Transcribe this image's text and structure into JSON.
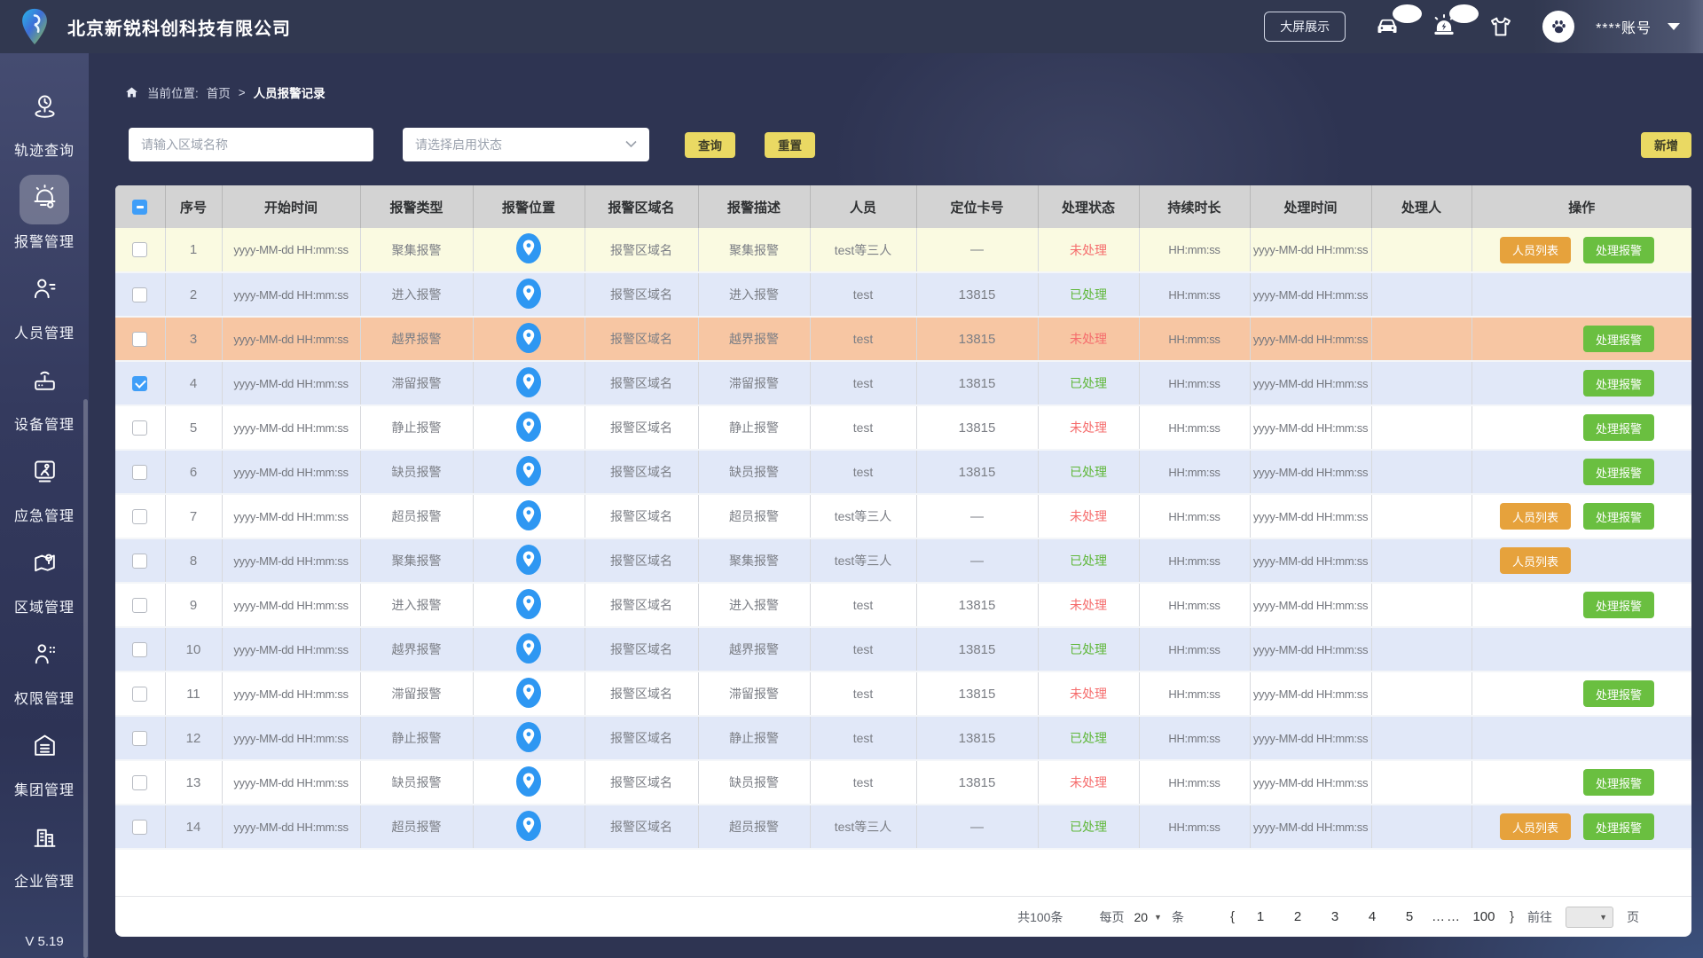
{
  "header": {
    "company_name": "北京新锐科创科技有限公司",
    "big_screen_label": "大屏展示",
    "account_label": "****账号",
    "icons": {
      "vehicle": "car-icon",
      "alarm": "siren-icon",
      "clothing": "tshirt-icon",
      "avatar": "paw-icon",
      "dropdown": "caret-down-icon"
    }
  },
  "sidebar": {
    "version": "V 5.19",
    "items": [
      {
        "id": "track",
        "label": "轨迹查询",
        "icon": "track-icon",
        "active": false
      },
      {
        "id": "alarm",
        "label": "报警管理",
        "icon": "alarm-icon",
        "active": true
      },
      {
        "id": "personnel",
        "label": "人员管理",
        "icon": "person-icon",
        "active": false
      },
      {
        "id": "device",
        "label": "设备管理",
        "icon": "device-icon",
        "active": false
      },
      {
        "id": "emergency",
        "label": "应急管理",
        "icon": "emergency-icon",
        "active": false
      },
      {
        "id": "region",
        "label": "区域管理",
        "icon": "region-icon",
        "active": false
      },
      {
        "id": "permission",
        "label": "权限管理",
        "icon": "permission-icon",
        "active": false
      },
      {
        "id": "group",
        "label": "集团管理",
        "icon": "group-icon",
        "active": false
      },
      {
        "id": "enterprise",
        "label": "企业管理",
        "icon": "enterprise-icon",
        "active": false
      }
    ]
  },
  "breadcrumb": {
    "prefix": "当前位置: ",
    "link": "首页",
    "separator": ">",
    "current": "人员报警记录"
  },
  "filters": {
    "area_placeholder": "请输入区域名称",
    "status_placeholder": "请选择启用状态",
    "search_label": "查询",
    "reset_label": "重置",
    "add_label": "新增"
  },
  "table": {
    "columns": [
      "序号",
      "开始时间",
      "报警类型",
      "报警位置",
      "报警区域名",
      "报警描述",
      "人员",
      "定位卡号",
      "处理状态",
      "持续时长",
      "处理时间",
      "处理人",
      "操作"
    ],
    "button_labels": {
      "person_list": "人员列表",
      "handle_alarm": "处理报警"
    },
    "status_values": {
      "pending": "未处理",
      "done": "已处理"
    },
    "rows": [
      {
        "index": 1,
        "start_time": "yyyy-MM-dd HH:mm:ss",
        "type": "聚集报警",
        "area": "报警区域名",
        "desc": "聚集报警",
        "person": "test等三人",
        "card": "—",
        "status": "未处理",
        "state": "pending",
        "duration": "HH:mm:ss",
        "handle_time": "yyyy-MM-dd HH:mm:ss",
        "handler": "",
        "buttons": [
          "person_list",
          "handle_alarm"
        ],
        "bg": "yellow",
        "checked": false
      },
      {
        "index": 2,
        "start_time": "yyyy-MM-dd HH:mm:ss",
        "type": "进入报警",
        "area": "报警区域名",
        "desc": "进入报警",
        "person": "test",
        "card": "13815",
        "status": "已处理",
        "state": "done",
        "duration": "HH:mm:ss",
        "handle_time": "yyyy-MM-dd HH:mm:ss",
        "handler": "",
        "buttons": [],
        "bg": "blue",
        "checked": false
      },
      {
        "index": 3,
        "start_time": "yyyy-MM-dd HH:mm:ss",
        "type": "越界报警",
        "area": "报警区域名",
        "desc": "越界报警",
        "person": "test",
        "card": "13815",
        "status": "未处理",
        "state": "pending",
        "duration": "HH:mm:ss",
        "handle_time": "yyyy-MM-dd HH:mm:ss",
        "handler": "",
        "buttons": [
          "handle_alarm"
        ],
        "bg": "orange",
        "checked": false
      },
      {
        "index": 4,
        "start_time": "yyyy-MM-dd HH:mm:ss",
        "type": "滞留报警",
        "area": "报警区域名",
        "desc": "滞留报警",
        "person": "test",
        "card": "13815",
        "status": "已处理",
        "state": "done",
        "duration": "HH:mm:ss",
        "handle_time": "yyyy-MM-dd HH:mm:ss",
        "handler": "",
        "buttons": [
          "handle_alarm"
        ],
        "bg": "blue",
        "checked": true
      },
      {
        "index": 5,
        "start_time": "yyyy-MM-dd HH:mm:ss",
        "type": "静止报警",
        "area": "报警区域名",
        "desc": "静止报警",
        "person": "test",
        "card": "13815",
        "status": "未处理",
        "state": "pending",
        "duration": "HH:mm:ss",
        "handle_time": "yyyy-MM-dd HH:mm:ss",
        "handler": "",
        "buttons": [
          "handle_alarm"
        ],
        "bg": "white",
        "checked": false
      },
      {
        "index": 6,
        "start_time": "yyyy-MM-dd HH:mm:ss",
        "type": "缺员报警",
        "area": "报警区域名",
        "desc": "缺员报警",
        "person": "test",
        "card": "13815",
        "status": "已处理",
        "state": "done",
        "duration": "HH:mm:ss",
        "handle_time": "yyyy-MM-dd HH:mm:ss",
        "handler": "",
        "buttons": [
          "handle_alarm"
        ],
        "bg": "blue",
        "checked": false
      },
      {
        "index": 7,
        "start_time": "yyyy-MM-dd HH:mm:ss",
        "type": "超员报警",
        "area": "报警区域名",
        "desc": "超员报警",
        "person": "test等三人",
        "card": "—",
        "status": "未处理",
        "state": "pending",
        "duration": "HH:mm:ss",
        "handle_time": "yyyy-MM-dd HH:mm:ss",
        "handler": "",
        "buttons": [
          "person_list",
          "handle_alarm"
        ],
        "bg": "white",
        "checked": false
      },
      {
        "index": 8,
        "start_time": "yyyy-MM-dd HH:mm:ss",
        "type": "聚集报警",
        "area": "报警区域名",
        "desc": "聚集报警",
        "person": "test等三人",
        "card": "—",
        "status": "已处理",
        "state": "done",
        "duration": "HH:mm:ss",
        "handle_time": "yyyy-MM-dd HH:mm:ss",
        "handler": "",
        "buttons": [
          "person_list"
        ],
        "bg": "blue",
        "checked": false
      },
      {
        "index": 9,
        "start_time": "yyyy-MM-dd HH:mm:ss",
        "type": "进入报警",
        "area": "报警区域名",
        "desc": "进入报警",
        "person": "test",
        "card": "13815",
        "status": "未处理",
        "state": "pending",
        "duration": "HH:mm:ss",
        "handle_time": "yyyy-MM-dd HH:mm:ss",
        "handler": "",
        "buttons": [
          "handle_alarm"
        ],
        "bg": "white",
        "checked": false
      },
      {
        "index": 10,
        "start_time": "yyyy-MM-dd HH:mm:ss",
        "type": "越界报警",
        "area": "报警区域名",
        "desc": "越界报警",
        "person": "test",
        "card": "13815",
        "status": "已处理",
        "state": "done",
        "duration": "HH:mm:ss",
        "handle_time": "yyyy-MM-dd HH:mm:ss",
        "handler": "",
        "buttons": [],
        "bg": "blue",
        "checked": false
      },
      {
        "index": 11,
        "start_time": "yyyy-MM-dd HH:mm:ss",
        "type": "滞留报警",
        "area": "报警区域名",
        "desc": "滞留报警",
        "person": "test",
        "card": "13815",
        "status": "未处理",
        "state": "pending",
        "duration": "HH:mm:ss",
        "handle_time": "yyyy-MM-dd HH:mm:ss",
        "handler": "",
        "buttons": [
          "handle_alarm"
        ],
        "bg": "white",
        "checked": false
      },
      {
        "index": 12,
        "start_time": "yyyy-MM-dd HH:mm:ss",
        "type": "静止报警",
        "area": "报警区域名",
        "desc": "静止报警",
        "person": "test",
        "card": "13815",
        "status": "已处理",
        "state": "done",
        "duration": "HH:mm:ss",
        "handle_time": "yyyy-MM-dd HH:mm:ss",
        "handler": "",
        "buttons": [],
        "bg": "blue",
        "checked": false
      },
      {
        "index": 13,
        "start_time": "yyyy-MM-dd HH:mm:ss",
        "type": "缺员报警",
        "area": "报警区域名",
        "desc": "缺员报警",
        "person": "test",
        "card": "13815",
        "status": "未处理",
        "state": "pending",
        "duration": "HH:mm:ss",
        "handle_time": "yyyy-MM-dd HH:mm:ss",
        "handler": "",
        "buttons": [
          "handle_alarm"
        ],
        "bg": "white",
        "checked": false
      },
      {
        "index": 14,
        "start_time": "yyyy-MM-dd HH:mm:ss",
        "type": "超员报警",
        "area": "报警区域名",
        "desc": "超员报警",
        "person": "test等三人",
        "card": "—",
        "status": "已处理",
        "state": "done",
        "duration": "HH:mm:ss",
        "handle_time": "yyyy-MM-dd HH:mm:ss",
        "handler": "",
        "buttons": [
          "person_list",
          "handle_alarm"
        ],
        "bg": "blue",
        "checked": false
      }
    ]
  },
  "pagination": {
    "total": "共100条",
    "per_page_prefix": "每页",
    "per_page_value": "20",
    "per_page_suffix": "条",
    "prev": "{",
    "pages": [
      "1",
      "2",
      "3",
      "4",
      "5"
    ],
    "ellipsis": "……",
    "last_page": "100",
    "next": "}",
    "goto_label": "前往",
    "page_suffix": "页"
  },
  "colors": {
    "header_navy": "#313850",
    "accent_blue": "#3f9ef8",
    "pin_blue": "#2e97f2",
    "status_red": "#f56c6c",
    "status_green": "#5fb73a",
    "button_orange": "#e6a23c",
    "button_green": "#6abf40",
    "button_yellow": "#ead963",
    "row_yellow": "#fafae1",
    "row_blue": "#e1e8f8",
    "row_orange": "#f7c6a3",
    "table_header_grey": "#d3d3d3"
  }
}
